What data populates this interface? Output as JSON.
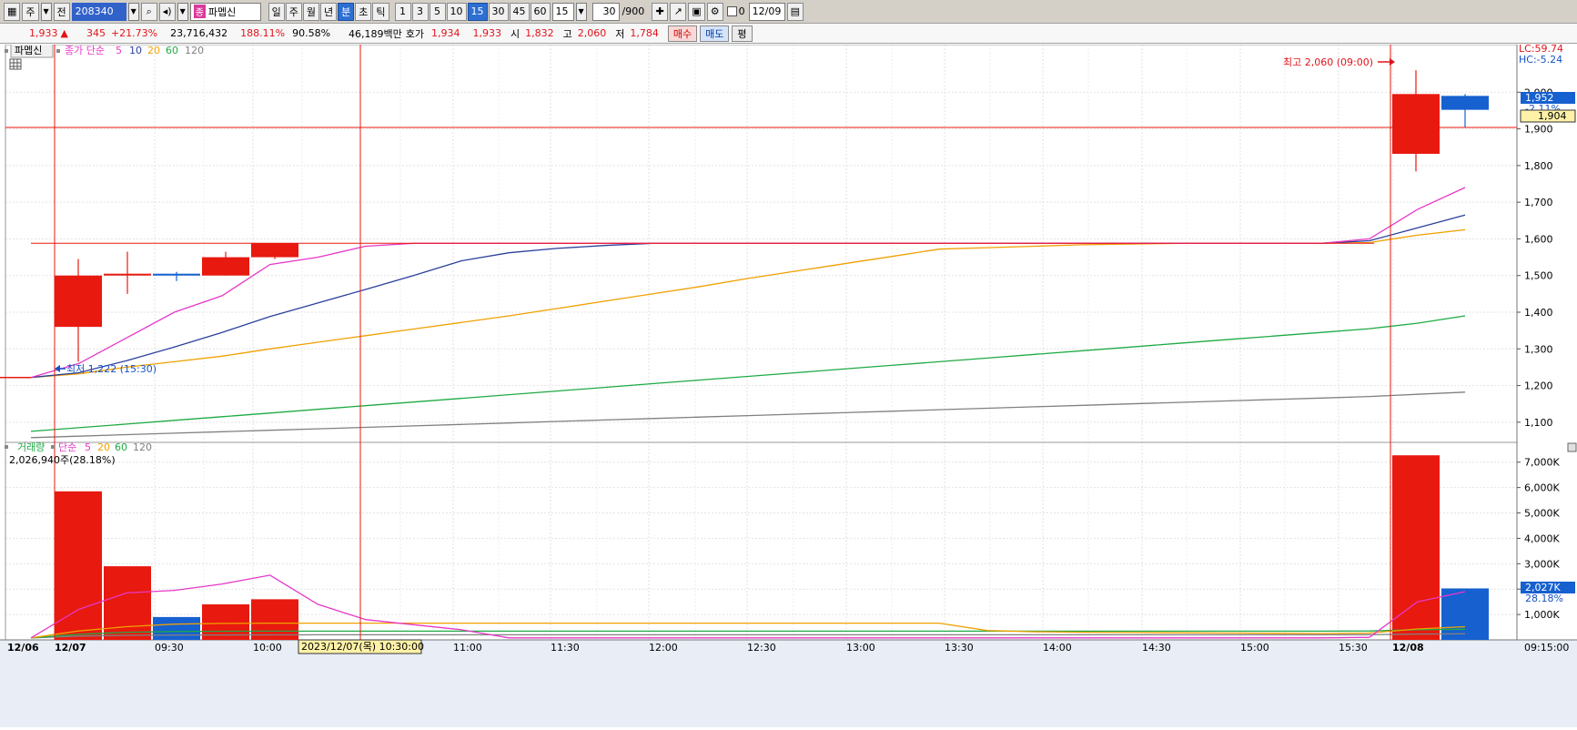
{
  "toolbar": {
    "period_label": "주",
    "jeon_label": "전",
    "code": "208340",
    "name_tag": "종",
    "stock_name": "파멥신",
    "tabs": [
      {
        "label": "일",
        "active": false
      },
      {
        "label": "주",
        "active": false
      },
      {
        "label": "월",
        "active": false
      },
      {
        "label": "년",
        "active": false
      },
      {
        "label": "분",
        "active": true
      },
      {
        "label": "초",
        "active": false
      },
      {
        "label": "틱",
        "active": false
      }
    ],
    "intervals": [
      {
        "label": "1",
        "active": false
      },
      {
        "label": "3",
        "active": false
      },
      {
        "label": "5",
        "active": false
      },
      {
        "label": "10",
        "active": false
      },
      {
        "label": "15",
        "active": true
      },
      {
        "label": "30",
        "active": false
      },
      {
        "label": "45",
        "active": false
      },
      {
        "label": "60",
        "active": false
      }
    ],
    "interval_select": "15",
    "count": "30",
    "count_total": "/900",
    "check_label": "0",
    "date_value": "12/09"
  },
  "info": {
    "price": "1,933",
    "arrow": "▲",
    "change": "345",
    "change_pct": "+21.73%",
    "volume": "23,716,432",
    "vol_ratio": "188.11%",
    "turnover": "90.58%",
    "amount": "46,189백만",
    "hoga_label": "호가",
    "ask": "1,934",
    "bid": "1,933",
    "open_label": "시",
    "open": "1,832",
    "high_label": "고",
    "high": "2,060",
    "low_label": "저",
    "low": "1,784",
    "buy_label": "매수",
    "sell_label": "매도",
    "eval_label": "평"
  },
  "price_panel": {
    "name_chip": "파멥신",
    "legend_prefix": "종가 단순",
    "ma_periods": [
      "5",
      "10",
      "20",
      "60",
      "120"
    ],
    "lc": "LC:59.74",
    "hc": "HC:-5.24",
    "high_annotation": "최고 2,060 (09:00)",
    "low_annotation": "최저 1,222 (15:30)",
    "current_badge": "1,952",
    "current_sub": "-2.11%",
    "crosshair_badge": "1,904"
  },
  "volume_panel": {
    "title": "거래량",
    "legend_prefix": "단순",
    "ma_periods": [
      "5",
      "20",
      "60",
      "120"
    ],
    "info": "2,026,940주(28.18%)",
    "current_badge": "2,027K",
    "current_sub": "28.18%"
  },
  "x_axis": {
    "labels": [
      "12/06",
      "12/07",
      "09:30",
      "10:00",
      "11:00",
      "11:30",
      "12:00",
      "12:30",
      "13:00",
      "13:30",
      "14:00",
      "14:30",
      "15:00",
      "15:30",
      "12/08",
      "09:15:00"
    ],
    "cursor_label": "2023/12/07(목) 10:30:00"
  },
  "colors": {
    "up": "#e8190f",
    "down": "#1660d0",
    "ma5": "#e638c8",
    "ma10": "#2a3f9c",
    "ma20": "#f0a000",
    "ma60": "#1faa44",
    "ma120": "#808080",
    "crosshair": "#e8190f"
  },
  "chart_data": {
    "type": "candlestick",
    "price_axis": {
      "ticks": [
        "2,000",
        "1,900",
        "1,800",
        "1,700",
        "1,600",
        "1,500",
        "1,400",
        "1,300",
        "1,200",
        "1,100"
      ],
      "ylim": [
        1045,
        2110
      ]
    },
    "volume_axis": {
      "ticks": [
        "7,000K",
        "6,000K",
        "5,000K",
        "4,000K",
        "3,000K",
        "2,000K",
        "1,000K"
      ],
      "ylim": [
        0,
        7600
      ]
    },
    "candles": [
      {
        "session": "12/07",
        "open": 1360,
        "high": 1545,
        "low": 1265,
        "close": 1500,
        "volume": 5850
      },
      {
        "session": "12/07",
        "open": 1505,
        "high": 1565,
        "low": 1450,
        "close": 1505,
        "volume": 2900
      },
      {
        "session": "12/07",
        "open": 1505,
        "high": 1510,
        "low": 1485,
        "close": 1500,
        "volume": 900
      },
      {
        "session": "12/07",
        "open": 1500,
        "high": 1565,
        "low": 1500,
        "close": 1550,
        "volume": 1400
      },
      {
        "session": "12/07",
        "open": 1550,
        "high": 1588,
        "low": 1545,
        "close": 1588,
        "volume": 1600
      },
      {
        "session": "12/08",
        "open": 1832,
        "high": 2060,
        "low": 1784,
        "close": 1995,
        "volume": 7270
      },
      {
        "session": "12/08",
        "open": 1990,
        "high": 1995,
        "low": 1904,
        "close": 1952,
        "volume": 2027
      }
    ],
    "ma": {
      "ma5": [
        1222,
        1260,
        1330,
        1400,
        1445,
        1530,
        1550,
        1580,
        1588,
        1588,
        1588,
        1588,
        1588,
        1588,
        1588,
        1588,
        1588,
        1588,
        1588,
        1588,
        1588,
        1588,
        1588,
        1588,
        1588,
        1588,
        1588,
        1588,
        1600,
        1680,
        1740
      ],
      "ma10": [
        1222,
        1235,
        1268,
        1305,
        1345,
        1388,
        1425,
        1462,
        1500,
        1540,
        1562,
        1574,
        1582,
        1588,
        1588,
        1588,
        1588,
        1588,
        1588,
        1588,
        1588,
        1588,
        1588,
        1588,
        1588,
        1588,
        1588,
        1588,
        1595,
        1630,
        1665
      ],
      "ma20": [
        1222,
        1232,
        1250,
        1265,
        1280,
        1300,
        1318,
        1336,
        1354,
        1372,
        1390,
        1410,
        1430,
        1450,
        1470,
        1492,
        1512,
        1532,
        1552,
        1572,
        1576,
        1580,
        1584,
        1586,
        1588,
        1588,
        1588,
        1588,
        1590,
        1610,
        1625
      ],
      "ma60": [
        1075,
        1085,
        1095,
        1105,
        1115,
        1125,
        1135,
        1145,
        1155,
        1165,
        1175,
        1185,
        1195,
        1205,
        1215,
        1225,
        1235,
        1245,
        1255,
        1265,
        1275,
        1285,
        1295,
        1305,
        1315,
        1325,
        1335,
        1345,
        1355,
        1370,
        1390
      ],
      "ma120": [
        1058,
        1062,
        1066,
        1070,
        1074,
        1078,
        1082,
        1086,
        1090,
        1094,
        1098,
        1102,
        1106,
        1110,
        1114,
        1118,
        1122,
        1126,
        1130,
        1134,
        1138,
        1142,
        1146,
        1150,
        1154,
        1158,
        1162,
        1166,
        1170,
        1176,
        1182
      ]
    },
    "vol_ma": {
      "ma5": [
        80,
        1200,
        1850,
        1950,
        2200,
        2550,
        1400,
        800,
        600,
        400,
        80,
        80,
        80,
        80,
        80,
        80,
        80,
        80,
        80,
        80,
        80,
        80,
        80,
        80,
        80,
        80,
        80,
        80,
        100,
        1500,
        1900
      ],
      "ma20": [
        80,
        350,
        520,
        620,
        650,
        660,
        660,
        660,
        660,
        660,
        660,
        660,
        660,
        660,
        660,
        660,
        660,
        660,
        660,
        660,
        370,
        320,
        300,
        290,
        280,
        270,
        260,
        250,
        270,
        430,
        520
      ],
      "ma60": [
        80,
        220,
        300,
        330,
        340,
        345,
        345,
        345,
        345,
        345,
        345,
        345,
        345,
        345,
        345,
        345,
        345,
        345,
        345,
        345,
        345,
        345,
        345,
        345,
        345,
        345,
        345,
        345,
        350,
        400,
        420
      ],
      "ma120": [
        80,
        150,
        180,
        190,
        195,
        198,
        200,
        200,
        200,
        200,
        200,
        200,
        200,
        200,
        200,
        200,
        200,
        200,
        200,
        200,
        200,
        200,
        200,
        200,
        200,
        200,
        200,
        200,
        205,
        230,
        240
      ]
    }
  }
}
